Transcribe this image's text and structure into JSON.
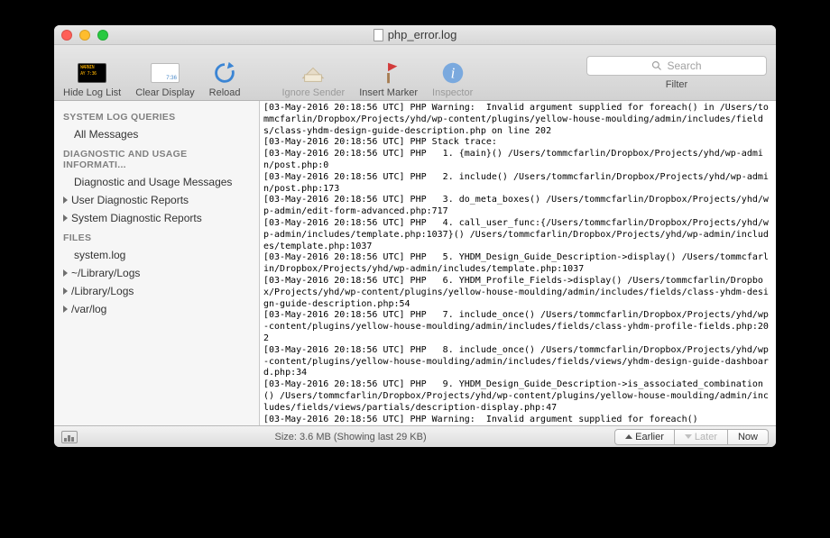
{
  "window": {
    "title": "php_error.log"
  },
  "toolbar": {
    "hide_log_list": "Hide Log List",
    "clear_display": "Clear Display",
    "reload": "Reload",
    "ignore_sender": "Ignore Sender",
    "insert_marker": "Insert Marker",
    "inspector": "Inspector",
    "filter": "Filter"
  },
  "search": {
    "placeholder": "Search"
  },
  "sidebar": {
    "section_system": "SYSTEM LOG QUERIES",
    "all_messages": "All Messages",
    "section_diag": "DIAGNOSTIC AND USAGE INFORMATI...",
    "diag_usage": "Diagnostic and Usage Messages",
    "user_diag": "User Diagnostic Reports",
    "system_diag": "System Diagnostic Reports",
    "section_files": "FILES",
    "system_log": "system.log",
    "lib_logs1": "~/Library/Logs",
    "lib_logs2": "/Library/Logs",
    "var_log": "/var/log"
  },
  "log": {
    "l1": "[03-May-2016 20:18:56 UTC] PHP Warning:  Invalid argument supplied for foreach() in /Users/tommcfarlin/Dropbox/Projects/yhd/wp-content/plugins/yellow-house-moulding/admin/includes/fields/class-yhdm-design-guide-description.php on line 202",
    "l2": "[03-May-2016 20:18:56 UTC] PHP Stack trace:",
    "l3": "[03-May-2016 20:18:56 UTC] PHP   1. {main}() /Users/tommcfarlin/Dropbox/Projects/yhd/wp-admin/post.php:0",
    "l4": "[03-May-2016 20:18:56 UTC] PHP   2. include() /Users/tommcfarlin/Dropbox/Projects/yhd/wp-admin/post.php:173",
    "l5": "[03-May-2016 20:18:56 UTC] PHP   3. do_meta_boxes() /Users/tommcfarlin/Dropbox/Projects/yhd/wp-admin/edit-form-advanced.php:717",
    "l6": "[03-May-2016 20:18:56 UTC] PHP   4. call_user_func:{/Users/tommcfarlin/Dropbox/Projects/yhd/wp-admin/includes/template.php:1037}() /Users/tommcfarlin/Dropbox/Projects/yhd/wp-admin/includes/template.php:1037",
    "l7": "[03-May-2016 20:18:56 UTC] PHP   5. YHDM_Design_Guide_Description->display() /Users/tommcfarlin/Dropbox/Projects/yhd/wp-admin/includes/template.php:1037",
    "l8": "[03-May-2016 20:18:56 UTC] PHP   6. YHDM_Profile_Fields->display() /Users/tommcfarlin/Dropbox/Projects/yhd/wp-content/plugins/yellow-house-moulding/admin/includes/fields/class-yhdm-design-guide-description.php:54",
    "l9": "[03-May-2016 20:18:56 UTC] PHP   7. include_once() /Users/tommcfarlin/Dropbox/Projects/yhd/wp-content/plugins/yellow-house-moulding/admin/includes/fields/class-yhdm-profile-fields.php:202",
    "l10": "[03-May-2016 20:18:56 UTC] PHP   8. include_once() /Users/tommcfarlin/Dropbox/Projects/yhd/wp-content/plugins/yellow-house-moulding/admin/includes/fields/views/yhdm-design-guide-dashboard.php:34",
    "l11": "[03-May-2016 20:18:56 UTC] PHP   9. YHDM_Design_Guide_Description->is_associated_combination() /Users/tommcfarlin/Dropbox/Projects/yhd/wp-content/plugins/yellow-house-moulding/admin/includes/fields/views/partials/description-display.php:47",
    "l12": "[03-May-2016 20:18:56 UTC] PHP Warning:  Invalid argument supplied for foreach()"
  },
  "status": {
    "size": "Size: 3.6 MB (Showing last 29 KB)",
    "earlier": "Earlier",
    "later": "Later",
    "now": "Now"
  }
}
